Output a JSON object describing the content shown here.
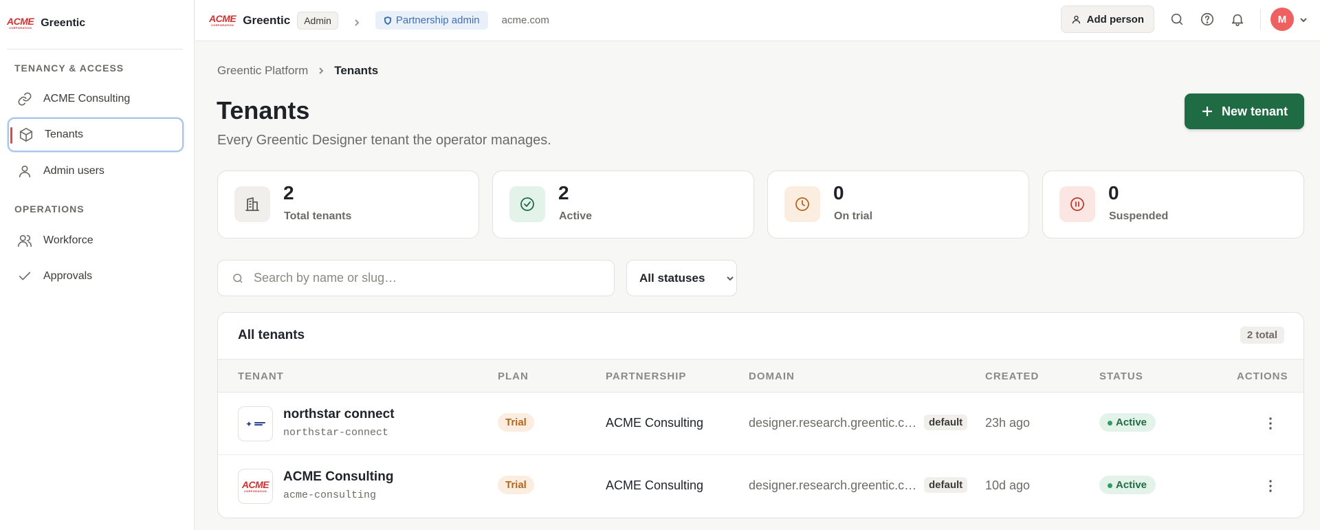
{
  "sidebar": {
    "brand_name": "Greentic",
    "logo_text": "ACME",
    "logo_subtext": "CORPORATION",
    "sections": [
      {
        "label": "TENANCY & ACCESS"
      },
      {
        "label": "OPERATIONS"
      }
    ],
    "items": [
      {
        "label": "ACME Consulting",
        "icon": "link-icon"
      },
      {
        "label": "Tenants",
        "icon": "cube-icon",
        "active": true
      },
      {
        "label": "Admin users",
        "icon": "user-icon"
      },
      {
        "label": "Workforce",
        "icon": "users-icon"
      },
      {
        "label": "Approvals",
        "icon": "check-icon"
      }
    ]
  },
  "topbar": {
    "brand_name": "Greentic",
    "role_badge": "Admin",
    "partnership_badge": "Partnership admin",
    "domain": "acme.com",
    "add_person_label": "Add person",
    "avatar_initial": "M"
  },
  "breadcrumb": {
    "parent": "Greentic Platform",
    "current": "Tenants"
  },
  "page": {
    "title": "Tenants",
    "subtitle": "Every Greentic Designer tenant the operator manages.",
    "new_button_label": "New tenant"
  },
  "stats": [
    {
      "value": "2",
      "label": "Total tenants",
      "icon": "building-icon",
      "color": "#f0efeb"
    },
    {
      "value": "2",
      "label": "Active",
      "icon": "check-circle-icon",
      "color": "#e4f3ea"
    },
    {
      "value": "0",
      "label": "On trial",
      "icon": "clock-icon",
      "color": "#fbeee0"
    },
    {
      "value": "0",
      "label": "Suspended",
      "icon": "pause-circle-icon",
      "color": "#fbe6e4"
    }
  ],
  "filters": {
    "search_placeholder": "Search by name or slug…",
    "status_selected": "All statuses"
  },
  "table": {
    "title": "All tenants",
    "total_badge": "2 total",
    "columns": [
      "TENANT",
      "PLAN",
      "PARTNERSHIP",
      "DOMAIN",
      "CREATED",
      "STATUS",
      "ACTIONS"
    ],
    "rows": [
      {
        "name": "northstar connect",
        "slug": "northstar-connect",
        "plan": "Trial",
        "partnership": "ACME Consulting",
        "domain": "designer.research.greentic.c…",
        "domain_badge": "default",
        "created": "23h ago",
        "status": "Active"
      },
      {
        "name": "ACME Consulting",
        "slug": "acme-consulting",
        "plan": "Trial",
        "partnership": "ACME Consulting",
        "domain": "designer.research.greentic.c…",
        "domain_badge": "default",
        "created": "10d ago",
        "status": "Active"
      }
    ]
  },
  "colors": {
    "primary": "#1f6b43",
    "accent_blue": "#3f6fb5",
    "brand_red": "#d32f2f",
    "avatar": "#ef6161"
  }
}
